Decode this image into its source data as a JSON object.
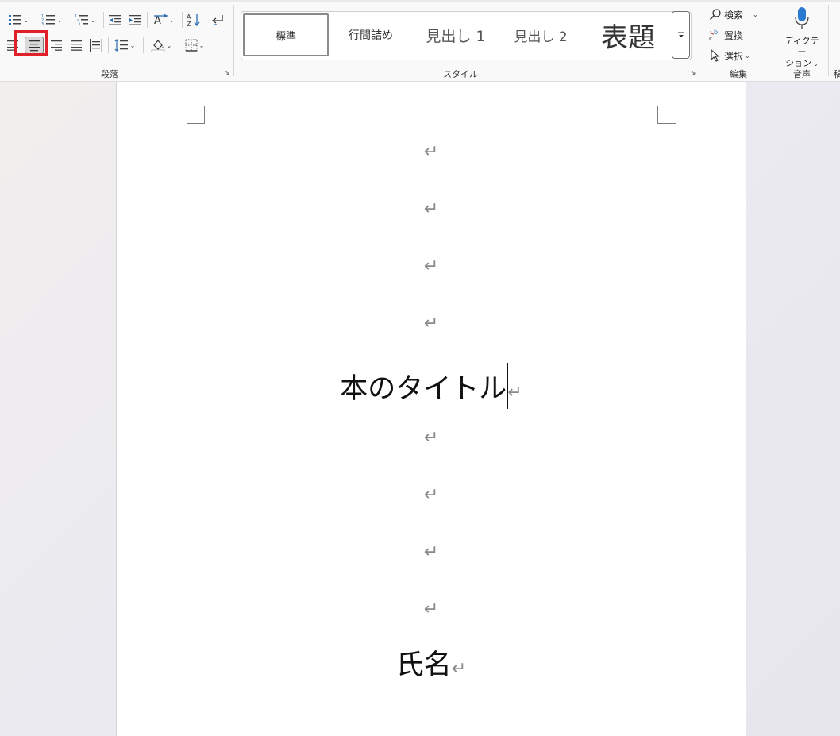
{
  "ribbon": {
    "groups": {
      "paragraph": "段落",
      "styles": "スタイル",
      "editing": "編集",
      "voice": "音声",
      "partial": "稿"
    },
    "styles_gallery": [
      {
        "label": "標準",
        "selected": true
      },
      {
        "label": "行間詰め",
        "selected": false
      },
      {
        "label": "見出し 1",
        "selected": false
      },
      {
        "label": "見出し 2",
        "selected": false
      },
      {
        "label": "表題",
        "selected": false
      }
    ],
    "editing": {
      "find": "検索",
      "replace": "置換",
      "select": "選択"
    },
    "voice": {
      "dictation_line1": "ディクテー",
      "dictation_line2": "ション"
    },
    "highlight_color": "#e0212b"
  },
  "document": {
    "title": "本のタイトル",
    "name": "氏名",
    "paragraph_mark": "↵"
  }
}
